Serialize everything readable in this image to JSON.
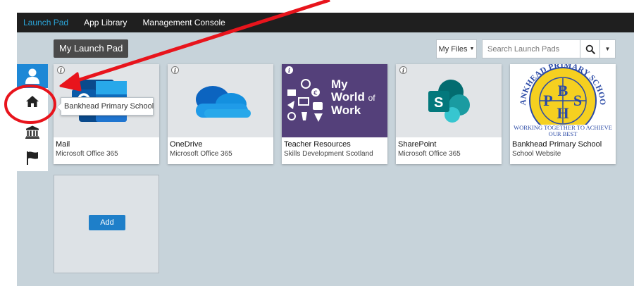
{
  "nav": {
    "items": [
      {
        "label": "Launch Pad",
        "active": true
      },
      {
        "label": "App Library",
        "active": false
      },
      {
        "label": "Management Console",
        "active": false
      }
    ]
  },
  "launchpad": {
    "title": "My Launch Pad"
  },
  "toolbar": {
    "my_files_label": "My Files",
    "search_placeholder": "Search Launch Pads"
  },
  "sidebar": {
    "icons": [
      "user-icon",
      "home-icon",
      "bank-icon",
      "flag-icon"
    ],
    "active_color": "#1e88d6"
  },
  "tooltip": {
    "text": "Bankhead Primary School"
  },
  "tiles": [
    {
      "name": "Mail",
      "subtitle": "Microsoft Office 365",
      "icon": "outlook-icon"
    },
    {
      "name": "OneDrive",
      "subtitle": "Microsoft Office 365",
      "icon": "onedrive-cloud-icon"
    },
    {
      "name": "Teacher Resources",
      "subtitle": "Skills Development Scotland",
      "icon": "my-world-of-work-logo",
      "logo_text": [
        "My",
        "World",
        "of",
        "Work"
      ]
    },
    {
      "name": "SharePoint",
      "subtitle": "Microsoft Office 365",
      "icon": "sharepoint-icon"
    },
    {
      "name": "Bankhead Primary School",
      "subtitle": "School Website",
      "icon": "school-crest-logo",
      "crest_text": {
        "top": "BANKHEAD PRIMARY SCHOOL",
        "bottom": "WORKING TOGETHER TO ACHIEVE OUR BEST",
        "letters": [
          "B",
          "P",
          "S",
          "H"
        ]
      }
    }
  ],
  "add_tile": {
    "label": "Add"
  },
  "colors": {
    "nav_bg": "#1f1f1f",
    "nav_active": "#2aa5d9",
    "canvas": "#c7d3da",
    "annotation": "#e8141c",
    "button": "#1e7fc9"
  }
}
